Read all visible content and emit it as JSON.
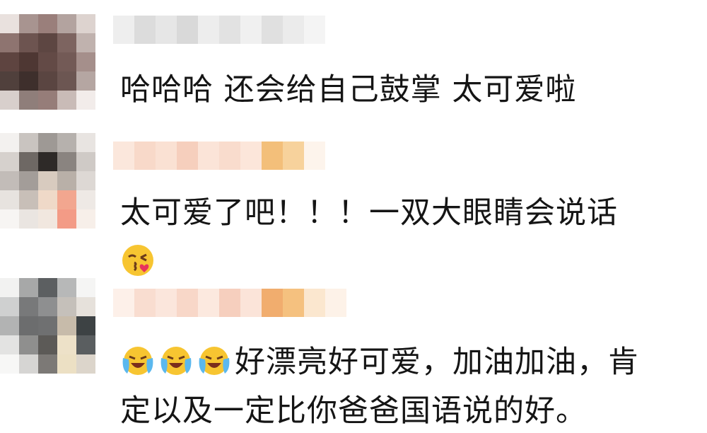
{
  "comments": [
    {
      "text": "哈哈哈 还会给自己鼓掌 太可爱啦"
    },
    {
      "text": "太可爱了吧！！！一双大眼睛会说话",
      "emojis": [
        "kiss-emoji"
      ]
    },
    {
      "lead_emojis": [
        "crying-laughing-emoji",
        "crying-laughing-emoji",
        "crying-laughing-emoji"
      ],
      "line1": "好漂亮好可爱，加油加油，肯",
      "line2": "定以及一定比你爸爸国语说的好。"
    }
  ]
}
